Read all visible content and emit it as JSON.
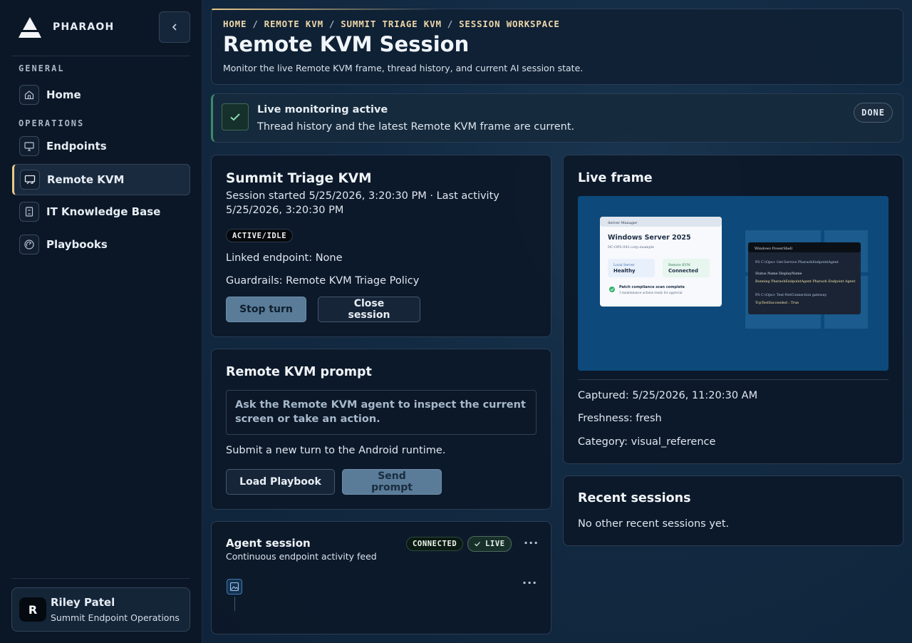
{
  "brand": {
    "name": "PHARAOH"
  },
  "sidebar": {
    "sections": [
      {
        "label": "GENERAL"
      },
      {
        "label": "OPERATIONS"
      }
    ],
    "items": [
      {
        "label": "Home",
        "icon": "home-icon"
      },
      {
        "label": "Endpoints",
        "icon": "monitor-icon"
      },
      {
        "label": "Remote KVM",
        "icon": "remote-screen-icon",
        "active": true
      },
      {
        "label": "IT Knowledge Base",
        "icon": "book-icon"
      },
      {
        "label": "Playbooks",
        "icon": "gauge-icon"
      }
    ],
    "user": {
      "initial": "R",
      "name": "Riley Patel",
      "org": "Summit Endpoint Operations"
    }
  },
  "header": {
    "breadcrumb": [
      "HOME",
      "REMOTE KVM",
      "SUMMIT TRIAGE KVM",
      "SESSION WORKSPACE"
    ],
    "title": "Remote KVM Session",
    "subtitle": "Monitor the live Remote KVM frame, thread history, and current AI session state."
  },
  "alert": {
    "title": "Live monitoring active",
    "text": "Thread history and the latest Remote KVM frame are current.",
    "badge": "DONE"
  },
  "session": {
    "title": "Summit Triage KVM",
    "started_line1": "Session started 5/25/2026, 3:20:30 PM · Last activity",
    "started_line2": "5/25/2026, 3:20:30 PM",
    "status": "ACTIVE/IDLE",
    "linked_endpoint": "Linked endpoint: None",
    "guardrails": "Guardrails: Remote KVM Triage Policy",
    "stop_label": "Stop turn",
    "close_label": "Close session"
  },
  "prompt": {
    "title": "Remote KVM prompt",
    "placeholder": "Ask the Remote KVM agent to inspect the current screen or take an action.",
    "hint": "Submit a new turn to the Android runtime.",
    "load_label": "Load Playbook",
    "send_label": "Send prompt"
  },
  "agent": {
    "title": "Agent session",
    "subtitle": "Continuous endpoint activity feed",
    "connected_chip": "CONNECTED",
    "live_chip": "LIVE",
    "more": "···"
  },
  "frame": {
    "title": "Live frame",
    "screenshot": {
      "server_manager": {
        "window_title": "Server Manager",
        "heading": "Windows Server 2025",
        "host": "DC-OPS-042.corp.example",
        "local_label": "Local Server",
        "local_value": "Healthy",
        "kvm_label": "Remote KVM",
        "kvm_value": "Connected",
        "patch_title": "Patch compliance scan complete",
        "patch_sub": "3 maintenance actions ready for approval"
      },
      "powershell": {
        "window_title": "Windows PowerShell",
        "lines": [
          "PS C:\\Ops> Get-Service PharaohEndpointAgent",
          "",
          "Status Name DisplayName",
          "Running PharaohEndpointAgent Pharaoh Endpoint Agent",
          "",
          "PS C:\\Ops> Test-NetConnection gateway",
          "TcpTestSucceeded : True"
        ]
      }
    },
    "captured": "Captured: 5/25/2026, 11:20:30 AM",
    "freshness": "Freshness: fresh",
    "category": "Category: visual_reference"
  },
  "recent": {
    "title": "Recent sessions",
    "empty": "No other recent sessions yet."
  },
  "colors": {
    "accent": "#e8c98a",
    "success": "#3d8a6a",
    "primary_button": "#5a7c98",
    "background": "#0f2236"
  }
}
